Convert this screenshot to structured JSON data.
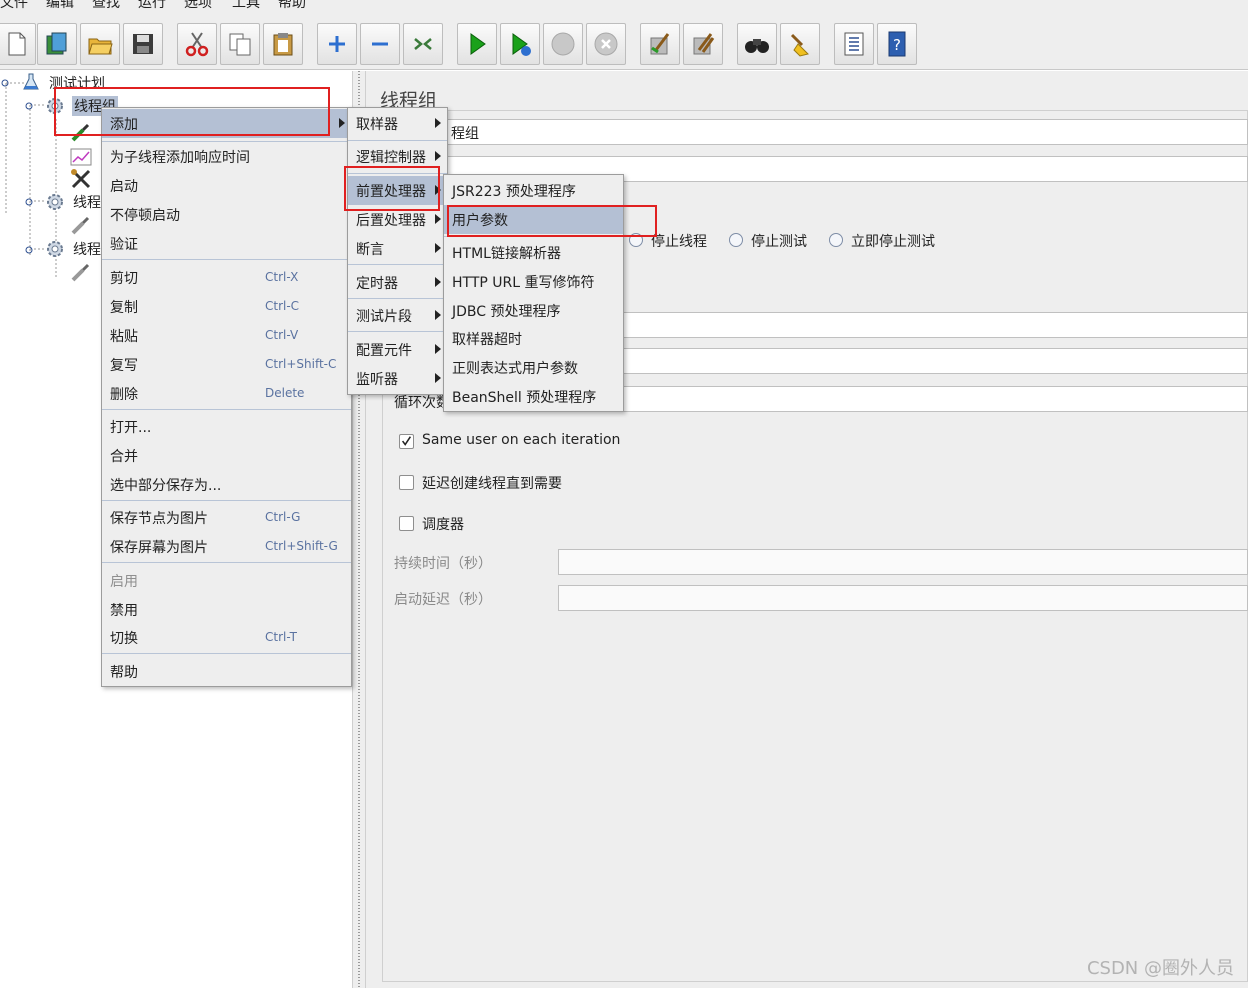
{
  "menubar": {
    "items": [
      "文件",
      "编辑",
      "查找",
      "运行",
      "选项",
      "工具",
      "帮助"
    ]
  },
  "toolbar": {
    "buttons": [
      "new-icon",
      "templates-icon",
      "open-icon",
      "save-icon",
      "cut-icon",
      "copy-icon",
      "paste-icon",
      "expand-icon",
      "collapse-icon",
      "toggle-icon",
      "start-icon",
      "start-no-pause-icon",
      "stop-icon",
      "shutdown-icon",
      "clear-icon",
      "clear-all-icon",
      "search-icon",
      "reset-search-icon",
      "function-helper-icon",
      "help-icon"
    ]
  },
  "tree": {
    "test_plan": "测试计划",
    "thread_group_1": "线程组",
    "thread_group_2": "线程",
    "thread_group_3": "线程"
  },
  "context_menu": {
    "add": "添加",
    "add_think_time": "为子线程添加响应时间",
    "start": "启动",
    "start_no_pause": "不停顿启动",
    "validate": "验证",
    "cut": "剪切",
    "cut_sc": "Ctrl-X",
    "copy": "复制",
    "copy_sc": "Ctrl-C",
    "paste": "粘贴",
    "paste_sc": "Ctrl-V",
    "duplicate": "复写",
    "duplicate_sc": "Ctrl+Shift-C",
    "delete": "删除",
    "delete_sc": "Delete",
    "open": "打开...",
    "merge": "合并",
    "save_selection": "选中部分保存为...",
    "save_node_image": "保存节点为图片",
    "save_node_image_sc": "Ctrl-G",
    "save_screen_image": "保存屏幕为图片",
    "save_screen_image_sc": "Ctrl+Shift-G",
    "enable": "启用",
    "disable": "禁用",
    "toggle": "切换",
    "toggle_sc": "Ctrl-T",
    "help": "帮助"
  },
  "add_submenu": {
    "sampler": "取样器",
    "logic_controller": "逻辑控制器",
    "pre_processors": "前置处理器",
    "post_processors": "后置处理器",
    "assertions": "断言",
    "timers": "定时器",
    "test_fragment": "测试片段",
    "config_element": "配置元件",
    "listener": "监听器"
  },
  "preprocessor_submenu": {
    "items": [
      "JSR223 预处理程序",
      "用户参数",
      "HTML链接解析器",
      "HTTP URL 重写修饰符",
      "JDBC 预处理程序",
      "取样器超时",
      "正则表达式用户参数",
      "BeanShell 预处理程序"
    ]
  },
  "panel": {
    "title": "线程组",
    "name_value": "程组",
    "radio_stop_thread": "停止线程",
    "radio_stop_test": "停止测试",
    "radio_stop_test_now": "立即停止测试",
    "loop_count_label": "循环次数",
    "same_user_label": "Same user on each iteration",
    "same_user_checked": true,
    "delay_create_label": "延迟创建线程直到需要",
    "scheduler_label": "调度器",
    "duration_label": "持续时间（秒）",
    "startup_delay_label": "启动延迟（秒）"
  },
  "watermark": "CSDN @圈外人员",
  "colors": {
    "menu_bg": "#eeeeee",
    "selection": "#b4c0d4",
    "annotation": "#e02020"
  }
}
